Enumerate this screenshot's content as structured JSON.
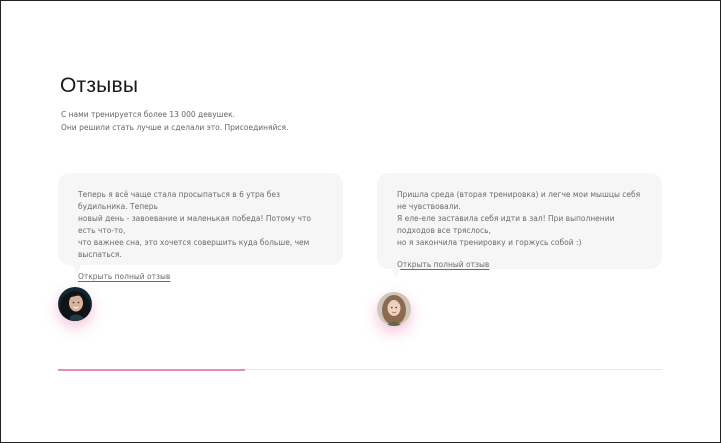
{
  "section": {
    "title": "Отзывы",
    "subtitle_line1": "С нами тренируется более 13 000 девушек.",
    "subtitle_line2": "Они решили стать лучше и сделали это. Присоединяйся."
  },
  "reviews": [
    {
      "line1": "Теперь я всё чаще стала просыпаться в 6 утра без будильника. Теперь",
      "line2": "новый день - завоевание и маленькая победа! Потому что есть что-то,",
      "line3": "что важнее сна, это хочется совершить куда больше, чем выспаться.",
      "link": "Открыть полный отзыв",
      "avatar_icon": "user-photo-dark-hair"
    },
    {
      "line1": "Пришла среда (вторая тренировка) и легче мои мышцы себя не чувствовали.",
      "line2": "Я еле-еле заставила себя идти в зал! При выполнении подходов все тряслось,",
      "line3": "но я закончила тренировку и горжусь собой :)",
      "link": "Открыть полный отзыв",
      "avatar_icon": "user-photo-light-hair"
    }
  ],
  "slider": {
    "progress": 0.31,
    "accent_color": "#e88bb8",
    "track_color": "#e6e6e6"
  }
}
